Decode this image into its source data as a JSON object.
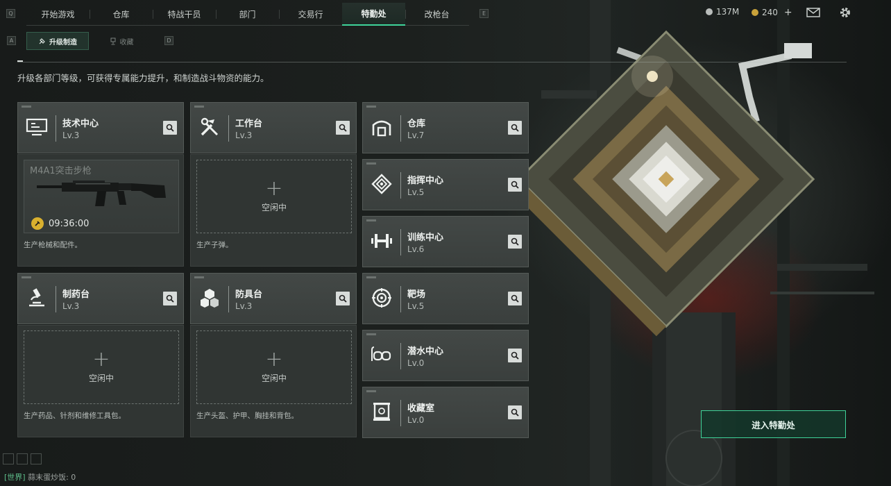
{
  "nav": {
    "left_key": "Q",
    "right_key": "E",
    "tabs": [
      {
        "label": "开始游戏",
        "active": false
      },
      {
        "label": "仓库",
        "active": false
      },
      {
        "label": "特战干员",
        "active": false
      },
      {
        "label": "部门",
        "active": false
      },
      {
        "label": "交易行",
        "active": false
      },
      {
        "label": "特勤处",
        "active": true
      },
      {
        "label": "改枪台",
        "active": false
      }
    ]
  },
  "currency": {
    "primary_value": "137M",
    "secondary_value": "240",
    "plus": "+"
  },
  "subnav": {
    "left_key": "A",
    "right_key": "D",
    "tabs": [
      {
        "label": "升级制造",
        "active": true
      },
      {
        "label": "收藏",
        "active": false
      }
    ]
  },
  "intro": "升级各部门等级，可获得专属能力提升，和制造战斗物资的能力。",
  "departments": [
    {
      "id": "tech",
      "name": "技术中心",
      "level": "Lv.3",
      "icon": "monitor-icon"
    },
    {
      "id": "workbench",
      "name": "工作台",
      "level": "Lv.3",
      "icon": "tools-icon"
    },
    {
      "id": "warehouse",
      "name": "仓库",
      "level": "Lv.7",
      "icon": "warehouse-icon"
    },
    {
      "id": "command",
      "name": "指挥中心",
      "level": "Lv.5",
      "icon": "command-icon"
    },
    {
      "id": "training",
      "name": "训练中心",
      "level": "Lv.6",
      "icon": "dumbbell-icon"
    },
    {
      "id": "pharmacy",
      "name": "制药台",
      "level": "Lv.3",
      "icon": "microscope-icon"
    },
    {
      "id": "armor",
      "name": "防具台",
      "level": "Lv.3",
      "icon": "cubes-icon"
    },
    {
      "id": "range",
      "name": "靶场",
      "level": "Lv.5",
      "icon": "target-icon"
    },
    {
      "id": "diving",
      "name": "潜水中心",
      "level": "Lv.0",
      "icon": "diving-mask-icon"
    },
    {
      "id": "collection",
      "name": "收藏室",
      "level": "Lv.0",
      "icon": "display-case-icon"
    }
  ],
  "production": {
    "tech": {
      "item": "M4A1突击步枪",
      "timer": "09:36:00",
      "desc": "生产枪械和配件。"
    },
    "workbench": {
      "idle": "空闲中",
      "desc": "生产子弹。"
    },
    "pharmacy": {
      "idle": "空闲中",
      "desc": "生产药品、针剂和维修工具包。"
    },
    "armor": {
      "idle": "空闲中",
      "desc": "生产头盔、护甲、胸挂和背包。"
    }
  },
  "enter_button": "进入特勤处",
  "chat": {
    "channel": "[世界]",
    "message": "蒜末蛋炒饭: 0"
  },
  "colors": {
    "accent": "#3fd49a",
    "timer": "#d9b02e",
    "gold": "#c9a23a"
  }
}
